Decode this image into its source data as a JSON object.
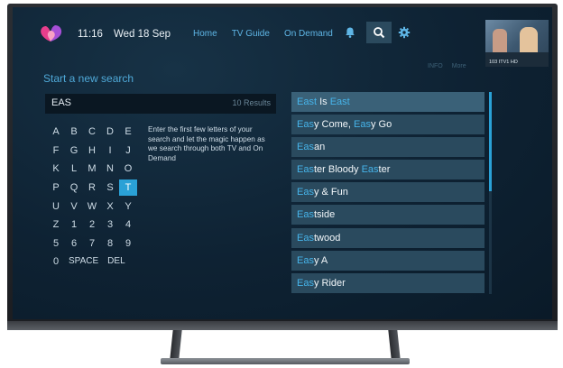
{
  "header": {
    "time": "11:16",
    "date": "Wed 18 Sep",
    "nav": [
      {
        "label": "Home"
      },
      {
        "label": "TV Guide"
      },
      {
        "label": "On Demand"
      }
    ],
    "icons": [
      "bell-icon",
      "search-icon",
      "gear-icon"
    ],
    "active_icon": "search-icon"
  },
  "preview": {
    "channel_label": "103 ITV1 HD"
  },
  "actions": {
    "info": "INFO",
    "more": "More"
  },
  "search": {
    "title": "Start a new search",
    "query": "EAS",
    "result_count": "10 Results",
    "hint": "Enter the first few letters of your search and let the magic happen as we search through both TV and On Demand"
  },
  "keyboard": {
    "rows": [
      [
        "A",
        "B",
        "C",
        "D",
        "E"
      ],
      [
        "F",
        "G",
        "H",
        "I",
        "J"
      ],
      [
        "K",
        "L",
        "M",
        "N",
        "O"
      ],
      [
        "P",
        "Q",
        "R",
        "S",
        "T"
      ],
      [
        "U",
        "V",
        "W",
        "X",
        "Y"
      ],
      [
        "Z",
        "1",
        "2",
        "3",
        "4"
      ],
      [
        "5",
        "6",
        "7",
        "8",
        "9"
      ],
      [
        "0",
        "SPACE",
        "DEL"
      ]
    ],
    "selected_key": "T"
  },
  "results": [
    {
      "parts": [
        {
          "text": "East",
          "hl": true
        },
        {
          "text": " Is ",
          "hl": false
        },
        {
          "text": "East",
          "hl": true
        }
      ]
    },
    {
      "parts": [
        {
          "text": "Eas",
          "hl": true
        },
        {
          "text": "y Come, ",
          "hl": false
        },
        {
          "text": "Eas",
          "hl": true
        },
        {
          "text": "y Go",
          "hl": false
        }
      ]
    },
    {
      "parts": [
        {
          "text": "Eas",
          "hl": true
        },
        {
          "text": "an",
          "hl": false
        }
      ]
    },
    {
      "parts": [
        {
          "text": "Eas",
          "hl": true
        },
        {
          "text": "ter Bloody ",
          "hl": false
        },
        {
          "text": "Eas",
          "hl": true
        },
        {
          "text": "ter",
          "hl": false
        }
      ]
    },
    {
      "parts": [
        {
          "text": "Eas",
          "hl": true
        },
        {
          "text": "y & Fun",
          "hl": false
        }
      ]
    },
    {
      "parts": [
        {
          "text": "Eas",
          "hl": true
        },
        {
          "text": "tside",
          "hl": false
        }
      ]
    },
    {
      "parts": [
        {
          "text": "Eas",
          "hl": true
        },
        {
          "text": "twood",
          "hl": false
        }
      ]
    },
    {
      "parts": [
        {
          "text": "Eas",
          "hl": true
        },
        {
          "text": "y A",
          "hl": false
        }
      ]
    },
    {
      "parts": [
        {
          "text": "Eas",
          "hl": true
        },
        {
          "text": "y Rider",
          "hl": false
        }
      ]
    }
  ],
  "colors": {
    "accent": "#2aa1d6",
    "highlight_text": "#46b4ea",
    "nav_text": "#5fb6e6",
    "result_bg": "#2a4a5e",
    "screen_bg": "#0e2233"
  }
}
